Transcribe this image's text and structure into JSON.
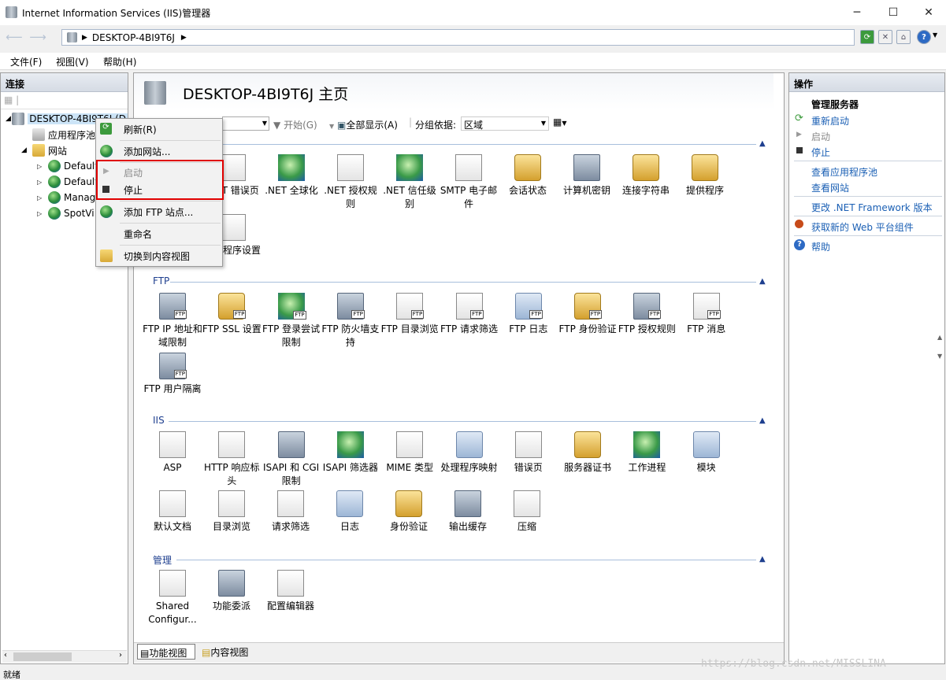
{
  "window": {
    "title": "Internet Information Services (IIS)管理器"
  },
  "address": {
    "path": "DESKTOP-4BI9T6J"
  },
  "menubar": {
    "file": "文件(F)",
    "view": "视图(V)",
    "help": "帮助(H)"
  },
  "connections": {
    "header": "连接",
    "server_node": "DESKTOP-4BI9T6J (D",
    "app_pools": "应用程序池",
    "sites": "网站",
    "site_items": [
      "Default",
      "Default",
      "Manag",
      "SpotVi"
    ]
  },
  "main": {
    "title": "DESKTOP-4BI9T6J 主页",
    "filter": {
      "start": "开始(G)",
      "show_all": "全部显示(A)",
      "group_label": "分组依据:",
      "group_value": "区域"
    },
    "aspnet_row": [
      ".NET 错误页",
      ".NET 全球化",
      ".NET 授权规则",
      ".NET 信任级别",
      "SMTP 电子邮件",
      "会话状态",
      "计算机密钥",
      "连接字符串",
      "提供程序"
    ],
    "aspnet_row2": [
      "应用程序设置"
    ],
    "sections": {
      "ftp": "FTP",
      "iis": "IIS",
      "manage": "管理"
    },
    "ftp_row1": [
      "FTP IP 地址和域限制",
      "FTP SSL 设置",
      "FTP 登录尝试限制",
      "FTP 防火墙支持",
      "FTP 目录浏览",
      "FTP 请求筛选",
      "FTP 日志",
      "FTP 身份验证",
      "FTP 授权规则",
      "FTP 消息"
    ],
    "ftp_row2": [
      "FTP 用户隔离"
    ],
    "iis_row1": [
      "ASP",
      "HTTP 响应标头",
      "ISAPI 和 CGI 限制",
      "ISAPI 筛选器",
      "MIME 类型",
      "处理程序映射",
      "错误页",
      "服务器证书",
      "工作进程",
      "模块"
    ],
    "iis_row2": [
      "默认文档",
      "目录浏览",
      "请求筛选",
      "日志",
      "身份验证",
      "输出缓存",
      "压缩"
    ],
    "manage_row": [
      "Shared Configur...",
      "功能委派",
      "配置编辑器"
    ],
    "tabs": {
      "features": "功能视图",
      "content": "内容视图"
    }
  },
  "context_menu": {
    "refresh": "刷新(R)",
    "add_site": "添加网站...",
    "start": "启动",
    "stop": "停止",
    "add_ftp": "添加 FTP 站点...",
    "rename": "重命名",
    "switch": "切换到内容视图"
  },
  "actions": {
    "header": "操作",
    "group": "管理服务器",
    "restart": "重新启动",
    "start": "启动",
    "stop": "停止",
    "view_pools": "查看应用程序池",
    "view_sites": "查看网站",
    "change_net": "更改 .NET Framework 版本",
    "get_web": "获取新的 Web 平台组件",
    "help": "帮助"
  },
  "status": {
    "text": "就绪"
  },
  "watermark": "https://blog.csdn.net/MISSLINA",
  "colors": {
    "accent": "#1a5fb4",
    "highlight_box": "#e00000",
    "section": "#1e3f8f"
  }
}
